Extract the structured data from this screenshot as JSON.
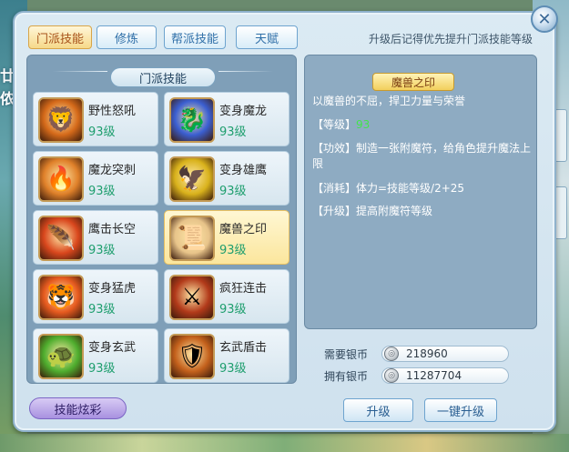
{
  "tabs": [
    {
      "label": "门派技能"
    },
    {
      "label": "修炼"
    },
    {
      "label": "帮派技能"
    },
    {
      "label": "天赋"
    }
  ],
  "hint": "升级后记得优先提升门派技能等级",
  "panel_title": "门派技能",
  "skills": [
    {
      "name": "野性怒吼",
      "level": "93级",
      "icon": "beast-roar-icon",
      "color": "#d56a1a"
    },
    {
      "name": "变身魔龙",
      "level": "93级",
      "icon": "dragon-transform-icon",
      "color": "#3b5fd1"
    },
    {
      "name": "魔龙突刺",
      "level": "93级",
      "icon": "dragon-thrust-icon",
      "color": "#e0812a"
    },
    {
      "name": "变身雄鹰",
      "level": "93级",
      "icon": "eagle-transform-icon",
      "color": "#d9b21c"
    },
    {
      "name": "鹰击长空",
      "level": "93级",
      "icon": "eagle-strike-icon",
      "color": "#d9471d"
    },
    {
      "name": "魔兽之印",
      "level": "93级",
      "icon": "beast-seal-icon",
      "color": "#e8c48a"
    },
    {
      "name": "变身猛虎",
      "level": "93级",
      "icon": "tiger-transform-icon",
      "color": "#e65a1f"
    },
    {
      "name": "疯狂连击",
      "level": "93级",
      "icon": "frenzy-combo-icon",
      "color": "#b23a1a"
    },
    {
      "name": "变身玄武",
      "level": "93级",
      "icon": "tortoise-transform-icon",
      "color": "#4fae2e"
    },
    {
      "name": "玄武盾击",
      "level": "93级",
      "icon": "tortoise-shield-icon",
      "color": "#c4611c"
    }
  ],
  "detail": {
    "title": "魔兽之印",
    "desc": "以魔兽的不屈，捍卫力量与荣誉",
    "level_label": "【等级】",
    "level_value": "93",
    "effect": "【功效】制造一张附魔符，给角色提升魔法上限",
    "cost": "【消耗】体力=技能等级/2+25",
    "upgrade": "【升级】提高附魔符等级"
  },
  "money": {
    "need_label": "需要银币",
    "need_value": "218960",
    "have_label": "拥有银币",
    "have_value": "11287704"
  },
  "buttons": {
    "flair": "技能炫彩",
    "upgrade": "升级",
    "one_click_upgrade": "一键升级"
  }
}
